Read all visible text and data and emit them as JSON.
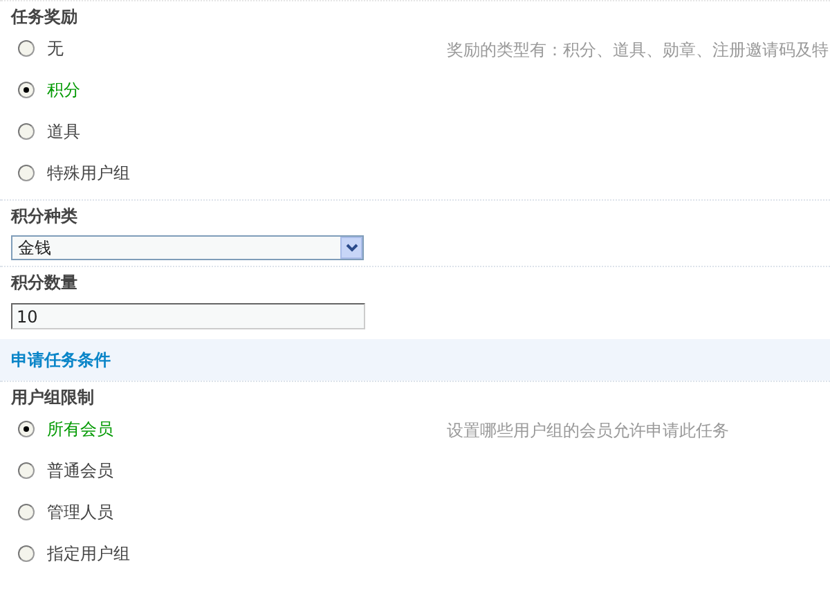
{
  "sections": [
    {
      "kind": "radio",
      "title": "任务奖励",
      "hint": "奖励的类型有：积分、道具、勋章、注册邀请码及特",
      "options": [
        {
          "label": "无",
          "selected": false
        },
        {
          "label": "积分",
          "selected": true
        },
        {
          "label": "道具",
          "selected": false
        },
        {
          "label": "特殊用户组",
          "selected": false
        }
      ]
    },
    {
      "kind": "select",
      "title": "积分种类",
      "value": "金钱"
    },
    {
      "kind": "input",
      "title": "积分数量",
      "value": "10"
    },
    {
      "kind": "header",
      "title": "申请任务条件"
    },
    {
      "kind": "radio",
      "title": "用户组限制",
      "hint": "设置哪些用户组的会员允许申请此任务",
      "options": [
        {
          "label": "所有会员",
          "selected": true
        },
        {
          "label": "普通会员",
          "selected": false
        },
        {
          "label": "管理人员",
          "selected": false
        },
        {
          "label": "指定用户组",
          "selected": false
        }
      ]
    }
  ]
}
